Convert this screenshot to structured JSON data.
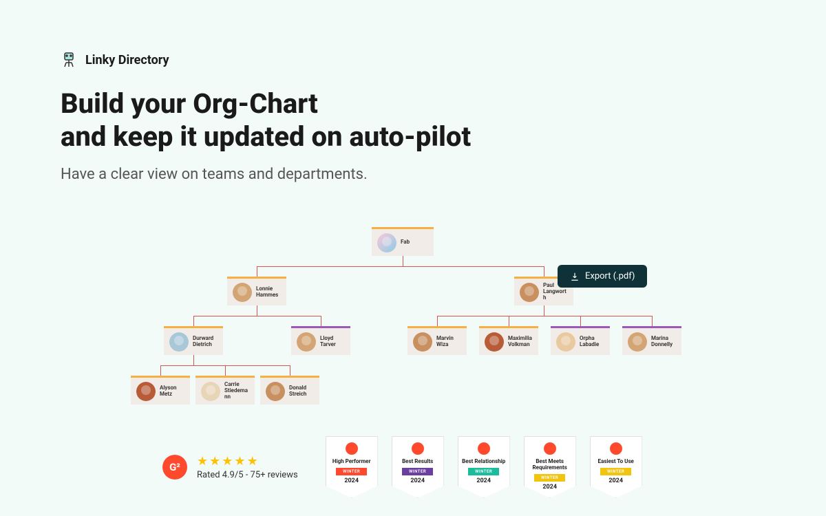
{
  "brand": {
    "name": "Linky Directory"
  },
  "headline_line1": "Build your Org-Chart",
  "headline_line2": "and keep it updated on auto-pilot",
  "subheadline": "Have a clear view on teams and departments.",
  "export_label": "Export (.pdf)",
  "org": {
    "root": {
      "name": "Fab",
      "color": "#f5b041",
      "avatar": "#f9c9d9"
    },
    "l2": [
      {
        "name": "Lonnie Hammes",
        "color": "#f5b041",
        "avatar": "#d4a574"
      },
      {
        "name": "Paul Langworth",
        "color": "#f5b041",
        "avatar": "#c89060"
      }
    ],
    "l3a": [
      {
        "name": "Durward Dietrich",
        "color": "#f5b041",
        "avatar": "#a8c8d8"
      },
      {
        "name": "Lloyd Tarver",
        "color": "#9b59b6",
        "avatar": "#d4a574"
      }
    ],
    "l3b": [
      {
        "name": "Marvin Wiza",
        "color": "#f5b041",
        "avatar": "#c89060"
      },
      {
        "name": "Maximilia Volkman",
        "color": "#f5b041",
        "avatar": "#b85c38"
      },
      {
        "name": "Orpha Labadie",
        "color": "#9b59b6",
        "avatar": "#e8c9a0"
      },
      {
        "name": "Marina Donnelly",
        "color": "#9b59b6",
        "avatar": "#d4a574"
      }
    ],
    "l4": [
      {
        "name": "Alyson Metz",
        "color": "#f5b041",
        "avatar": "#b85c38"
      },
      {
        "name": "Carrie Stiedemann",
        "color": "#f5b041",
        "avatar": "#e8d5b8"
      },
      {
        "name": "Donald Streich",
        "color": "#f5b041",
        "avatar": "#c89060"
      }
    ]
  },
  "rating": {
    "stars": 5,
    "text": "Rated 4.9/5  -  75+ reviews"
  },
  "badges": [
    {
      "title": "High Performer",
      "ribbon": "WINTER",
      "year": "2024",
      "color": "#ff492c"
    },
    {
      "title": "Best Results",
      "ribbon": "WINTER",
      "year": "2024",
      "color": "#6b3fa0"
    },
    {
      "title": "Best Relationship",
      "ribbon": "WINTER",
      "year": "2024",
      "color": "#1abc9c"
    },
    {
      "title": "Best Meets Requirements",
      "ribbon": "WINTER",
      "year": "2024",
      "color": "#f1c40f"
    },
    {
      "title": "Easiest To Use",
      "ribbon": "WINTER",
      "year": "2024",
      "color": "#f1c40f"
    }
  ]
}
